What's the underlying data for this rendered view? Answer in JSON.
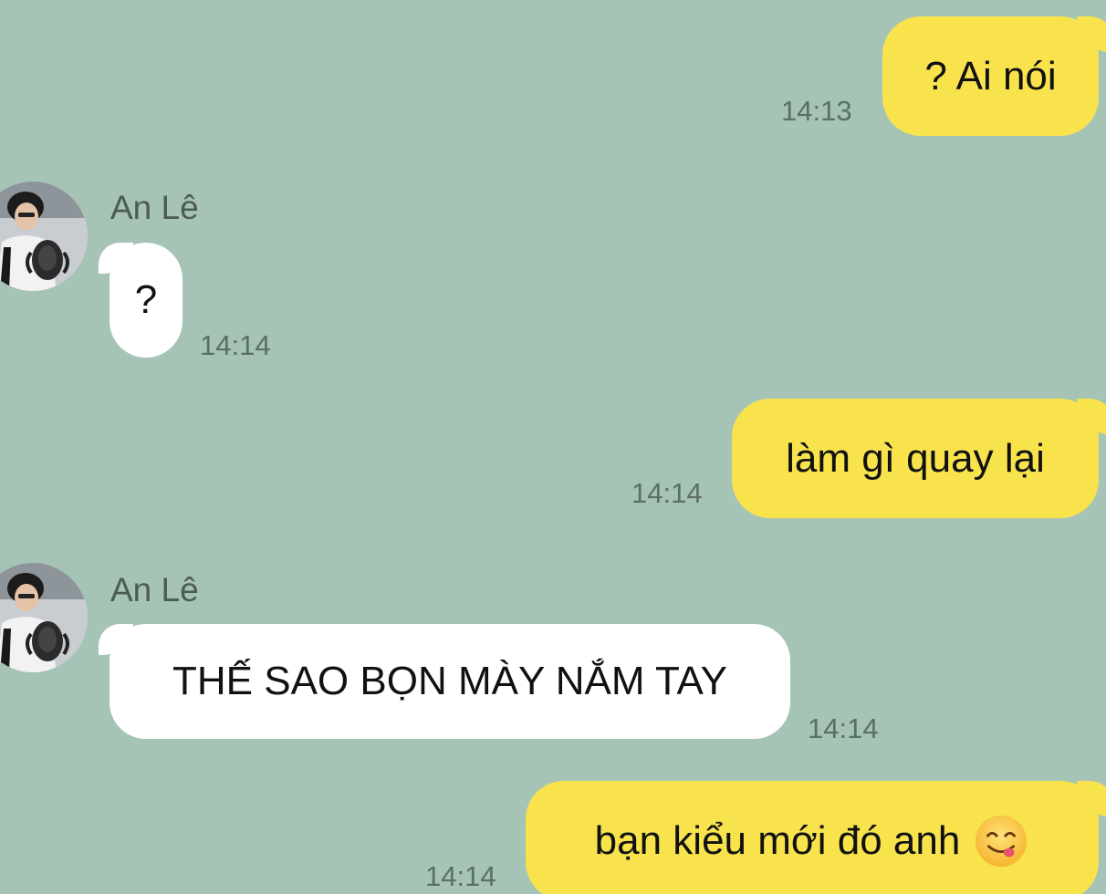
{
  "colors": {
    "background": "#a6c4b6",
    "outgoing_bubble": "#f9e34d",
    "incoming_bubble": "#ffffff",
    "timestamp": "#5c6f66",
    "sender_name": "#4d5b55"
  },
  "messages": [
    {
      "direction": "outgoing",
      "text": "? Ai nói",
      "time": "14:13"
    },
    {
      "direction": "incoming",
      "sender": "An Lê",
      "avatar": "trophy-photo-avatar",
      "text": "?",
      "time": "14:14"
    },
    {
      "direction": "outgoing",
      "text": "làm gì quay lại",
      "time": "14:14"
    },
    {
      "direction": "incoming",
      "sender": "An Lê",
      "avatar": "trophy-photo-avatar",
      "text": "THẾ SAO BỌN MÀY NẮM TAY",
      "time": "14:14"
    },
    {
      "direction": "outgoing",
      "text": "bạn kiểu mới đó anh",
      "emoji": "yum-face-emoji",
      "time": "14:14"
    }
  ]
}
